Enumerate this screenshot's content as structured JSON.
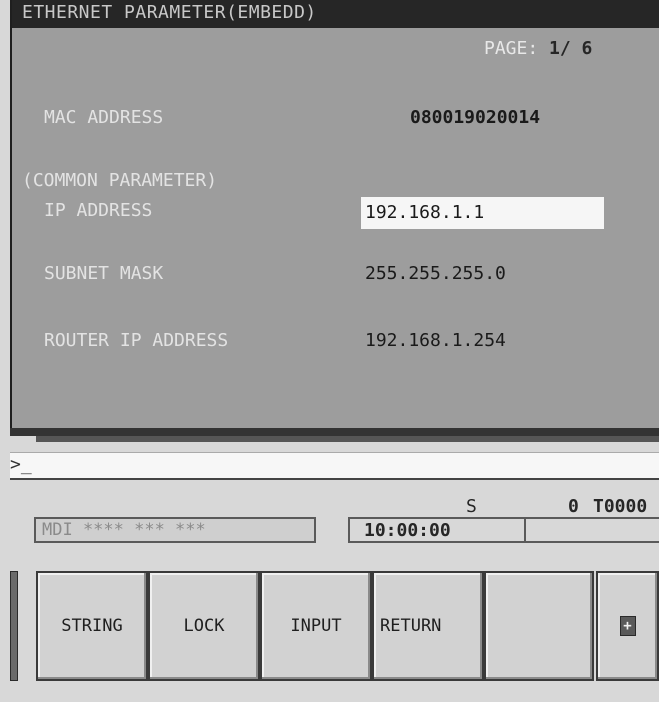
{
  "screen": {
    "title": "ETHERNET PARAMETER(EMBEDD)",
    "page_label": "PAGE:",
    "page_current": "1",
    "page_total": "/ 6",
    "mac": {
      "label": "MAC ADDRESS",
      "value": "080019020014"
    },
    "section_header": "(COMMON PARAMETER)",
    "ip": {
      "label": "IP ADDRESS",
      "value": "192.168.1.1"
    },
    "subnet": {
      "label": "SUBNET MASK",
      "value": "255.255.255.0"
    },
    "router": {
      "label": "ROUTER IP ADDRESS",
      "value": "192.168.1.254"
    }
  },
  "keyin": {
    "prompt": ">_"
  },
  "status": {
    "spindle_label": "S",
    "spindle_value": "0",
    "tool_value": "T0000",
    "mode_text": "MDI **** *** ***",
    "clock": "10:00:00"
  },
  "softkeys": [
    {
      "label": "STRING"
    },
    {
      "label": "LOCK"
    },
    {
      "label": "INPUT"
    },
    {
      "label": "RETURN"
    },
    {
      "label": ""
    },
    {
      "label": "+"
    }
  ],
  "colors": {
    "panel_bg": "#9d9d9d",
    "title_bar": "#262626",
    "field_highlight": "#f6f6f6",
    "softkey_bg": "#d2d2d2"
  }
}
